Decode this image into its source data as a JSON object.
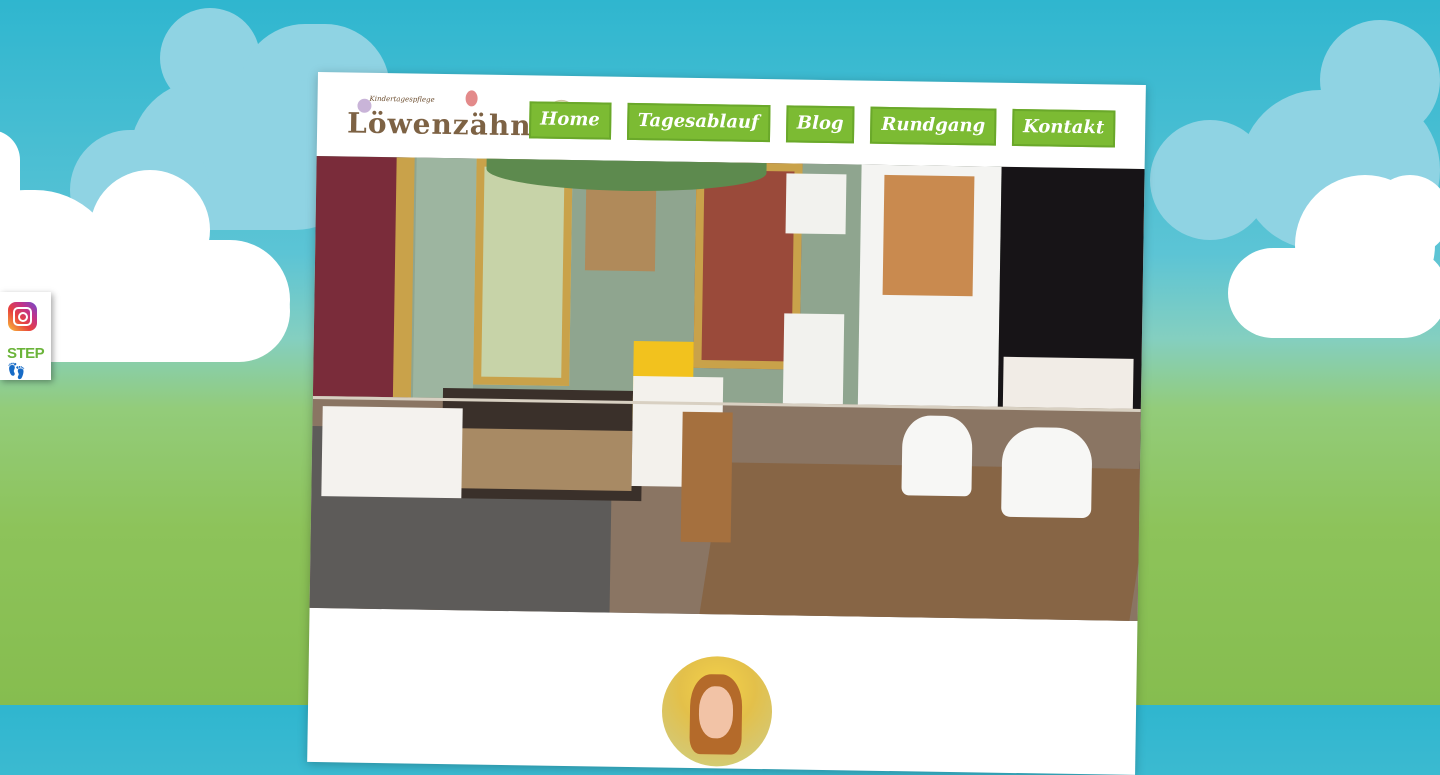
{
  "social": {
    "instagram_icon": "instagram-icon",
    "step_label": "STEP"
  },
  "logo": {
    "tagline": "Kindertagespflege",
    "title": "Löwenzähnchen"
  },
  "nav": {
    "items": [
      {
        "label": "Home"
      },
      {
        "label": "Tagesablauf"
      },
      {
        "label": "Blog"
      },
      {
        "label": "Rundgang"
      },
      {
        "label": "Kontakt"
      }
    ]
  },
  "colors": {
    "nav_green": "#7cbb33",
    "sky": "#2fb6cf",
    "grass": "#8dc35a"
  }
}
